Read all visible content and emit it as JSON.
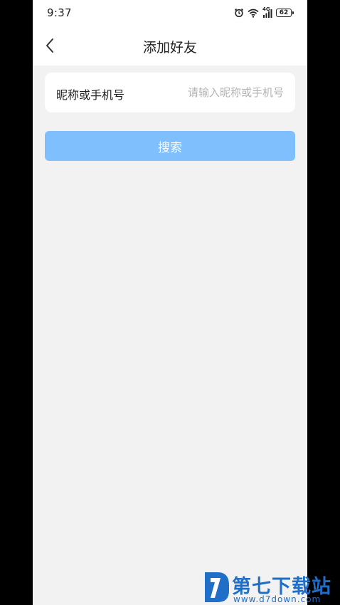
{
  "status_bar": {
    "time": "9:37",
    "network": "4G",
    "battery": "62",
    "icons": [
      "alarm-icon",
      "wifi-icon",
      "signal-icon",
      "battery-icon"
    ]
  },
  "nav": {
    "title": "添加好友",
    "back_icon": "chevron-left-icon"
  },
  "form": {
    "label": "昵称或手机号",
    "placeholder": "请输入昵称或手机号",
    "value": ""
  },
  "search_button": {
    "label": "搜索"
  },
  "watermark": {
    "title": "第七下载站",
    "url": "www.d7down.com"
  },
  "colors": {
    "background": "#f2f2f2",
    "button": "#80bffe",
    "watermark": "#1f6fc9"
  }
}
